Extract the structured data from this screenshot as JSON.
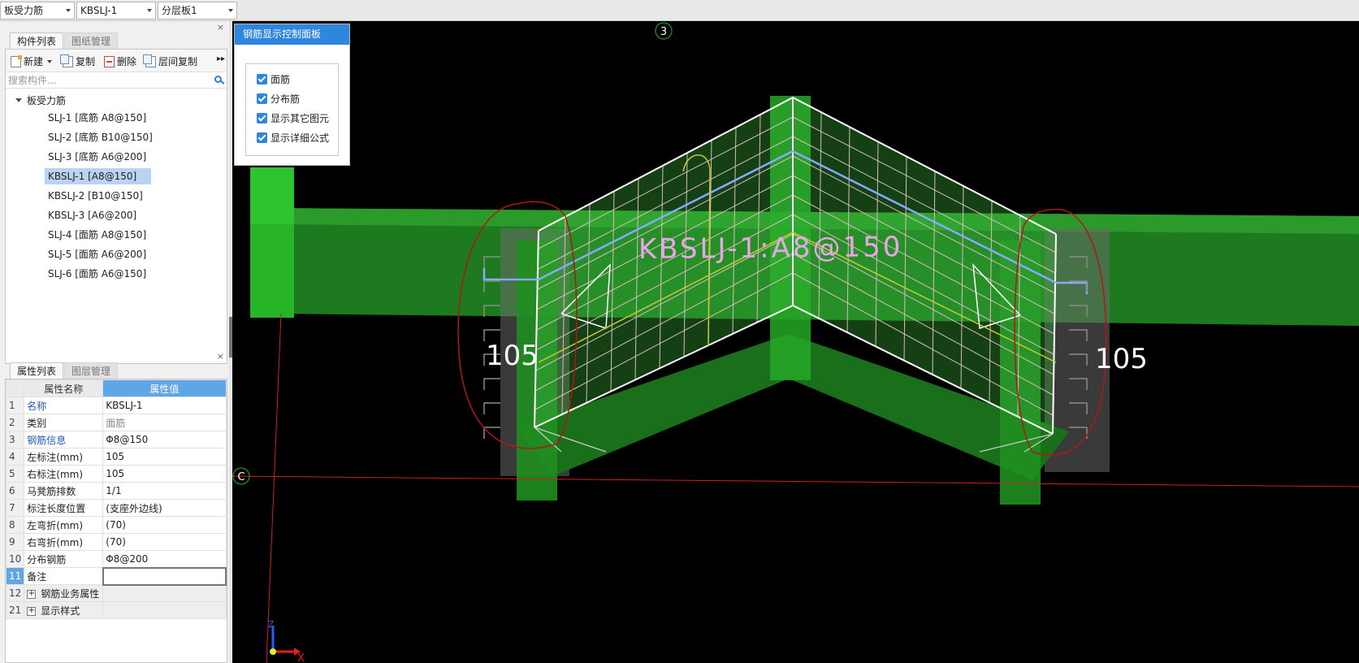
{
  "topbar": {
    "combo1": "板受力筋",
    "combo2": "KBSLJ-1",
    "combo3": "分层板1"
  },
  "component_panel": {
    "tabs": [
      "构件列表",
      "图纸管理"
    ],
    "toolbar": {
      "new_label": "新建",
      "copy_label": "复制",
      "delete_label": "删除",
      "floor_copy_label": "层间复制"
    },
    "search_placeholder": "搜索构件...",
    "tree": {
      "root_label": "板受力筋",
      "items": [
        "SLJ-1 [底筋 A8@150]",
        "SLJ-2 [底筋 B10@150]",
        "SLJ-3 [底筋 A6@200]",
        "KBSLJ-1 [A8@150]",
        "KBSLJ-2 [B10@150]",
        "KBSLJ-3 [A6@200]",
        "SLJ-4 [面筋 A8@150]",
        "SLJ-5 [面筋 A6@200]",
        "SLJ-6 [面筋 A6@150]"
      ],
      "selected": "KBSLJ-1 [A8@150]"
    }
  },
  "property_panel": {
    "tabs": [
      "属性列表",
      "图层管理"
    ],
    "headers": {
      "name": "属性名称",
      "value": "属性值"
    },
    "rows": [
      {
        "idx": "1",
        "name": "名称",
        "value": "KBSLJ-1"
      },
      {
        "idx": "2",
        "name": "类别",
        "value": "面筋"
      },
      {
        "idx": "3",
        "name": "钢筋信息",
        "value": "Φ8@150"
      },
      {
        "idx": "4",
        "name": "左标注(mm)",
        "value": "105"
      },
      {
        "idx": "5",
        "name": "右标注(mm)",
        "value": "105"
      },
      {
        "idx": "6",
        "name": "马凳筋排数",
        "value": "1/1"
      },
      {
        "idx": "7",
        "name": "标注长度位置",
        "value": "(支座外边线)"
      },
      {
        "idx": "8",
        "name": "左弯折(mm)",
        "value": "(70)"
      },
      {
        "idx": "9",
        "name": "右弯折(mm)",
        "value": "(70)"
      },
      {
        "idx": "10",
        "name": "分布钢筋",
        "value": "Φ8@200"
      },
      {
        "idx": "11",
        "name": "备注",
        "value": ""
      },
      {
        "idx": "12",
        "name": "钢筋业务属性",
        "value": ""
      },
      {
        "idx": "21",
        "name": "显示样式",
        "value": ""
      }
    ]
  },
  "control_panel": {
    "title": "钢筋显示控制面板",
    "options": [
      "面筋",
      "分布筋",
      "显示其它图元",
      "显示详细公式"
    ]
  },
  "viewport": {
    "axis_top": "3",
    "axis_left": "C",
    "rebar_label": "KBSLJ-1:A8@150",
    "left_dim": "105",
    "right_dim": "105",
    "axis_x": "X",
    "axis_z": "Z"
  }
}
